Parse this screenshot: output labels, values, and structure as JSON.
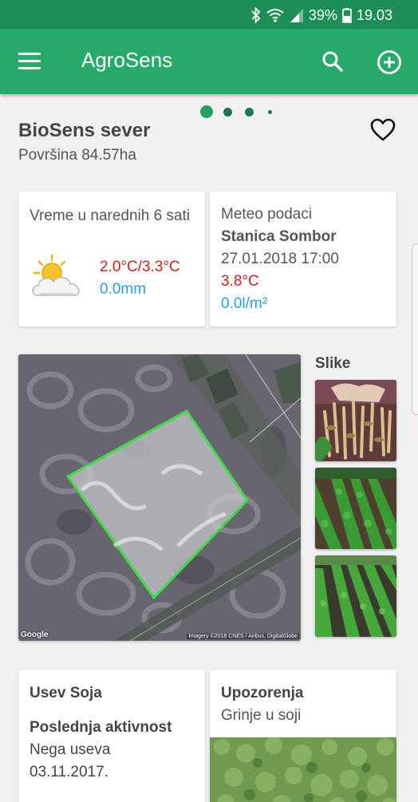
{
  "status_bar": {
    "battery": "39%",
    "time": "19.03",
    "icons": [
      "bluetooth-icon",
      "wifi-icon",
      "signal-icon",
      "battery-icon"
    ]
  },
  "app_bar": {
    "title": "AgroSens",
    "icons": [
      "menu-icon",
      "search-icon",
      "add-icon"
    ]
  },
  "field": {
    "name": "BioSens sever",
    "area": "Površina 84.57ha",
    "favorite_icon": "heart-icon"
  },
  "weather": {
    "title": "Vreme u narednih 6 sati",
    "temperature": "2.0°C/3.3°C",
    "precipitation": "0.0mm",
    "icon": "partly-cloudy-icon"
  },
  "meteo": {
    "title": "Meteo podaci",
    "station": "Stanica Sombor",
    "datetime": "27.01.2018 17:00",
    "temperature": "3.8°C",
    "precipitation": "0.0l/m²"
  },
  "map": {
    "logo": "Google",
    "credit": "Imagery ©2018 CNES / Airbus, DigitalGlobe"
  },
  "photos": {
    "title": "Slike"
  },
  "crop": {
    "title": "Usev Soja",
    "activity_label": "Poslednja aktivnost",
    "activity": "Nega useva",
    "date": "03.11.2017."
  },
  "warnings": {
    "title": "Upozorenja",
    "text": "Grinje u soji"
  },
  "colors": {
    "status_bar": "#1e8e58",
    "app_bar": "#27a96a",
    "temp_red": "#cc1f1f",
    "rain_blue": "#2a9fe0",
    "field_outline": "#3ddc45"
  }
}
